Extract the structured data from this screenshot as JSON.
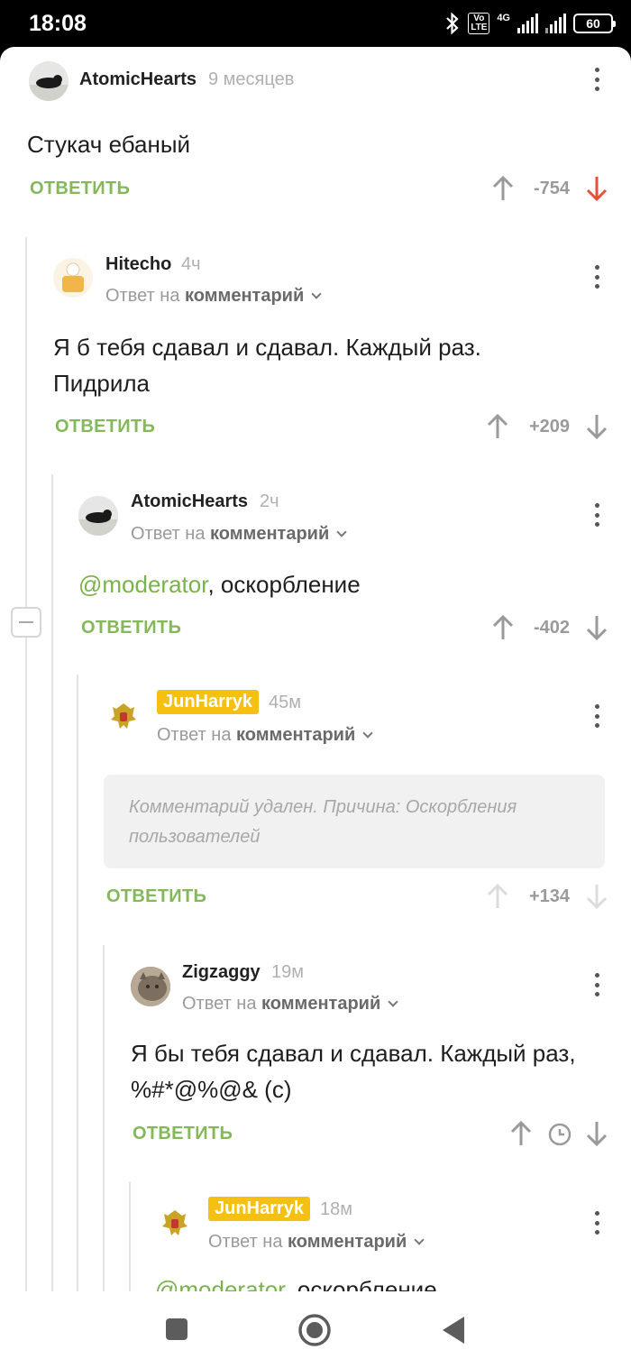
{
  "status_bar": {
    "time": "18:08",
    "network": "4G",
    "volte": "Vo LTE",
    "battery": "60"
  },
  "comments": [
    {
      "user": "AtomicHearts",
      "time": "9 месяцев",
      "text": "Стукач ебаный",
      "reply_label": "ОТВЕТИТЬ",
      "score": "-754",
      "vote": "down"
    },
    {
      "user": "Hitecho",
      "time": "4ч",
      "reply_to_prefix": "Ответ на",
      "reply_to_target": "комментарий",
      "text": "Я б тебя сдавал и сдавал. Каждый раз. Пидрила",
      "reply_label": "ОТВЕТИТЬ",
      "score": "+209"
    },
    {
      "user": "AtomicHearts",
      "time": "2ч",
      "reply_to_prefix": "Ответ на",
      "reply_to_target": "комментарий",
      "mention": "@moderator",
      "text_after_mention": ", оскорбление",
      "reply_label": "ОТВЕТИТЬ",
      "score": "-402"
    },
    {
      "user": "JunHarryk",
      "time": "45м",
      "reply_to_prefix": "Ответ на",
      "reply_to_target": "комментарий",
      "deleted_text": "Комментарий удален. Причина: Оскорбления пользователей",
      "reply_label": "ОТВЕТИТЬ",
      "score": "+134"
    },
    {
      "user": "Zigzaggy",
      "time": "19м",
      "reply_to_prefix": "Ответ на",
      "reply_to_target": "комментарий",
      "text": "Я бы тебя сдавал и сдавал. Каждый раз, %#*@%@& (с)",
      "reply_label": "ОТВЕТИТЬ",
      "score": ""
    },
    {
      "user": "JunHarryk",
      "time": "18м",
      "reply_to_prefix": "Ответ на",
      "reply_to_target": "комментарий",
      "mention": "@moderator",
      "text_after_mention": ", оскорбление"
    }
  ],
  "colors": {
    "accent_green": "#85b85a",
    "downvote_red": "#e8503a",
    "badge_yellow": "#f6c012"
  }
}
